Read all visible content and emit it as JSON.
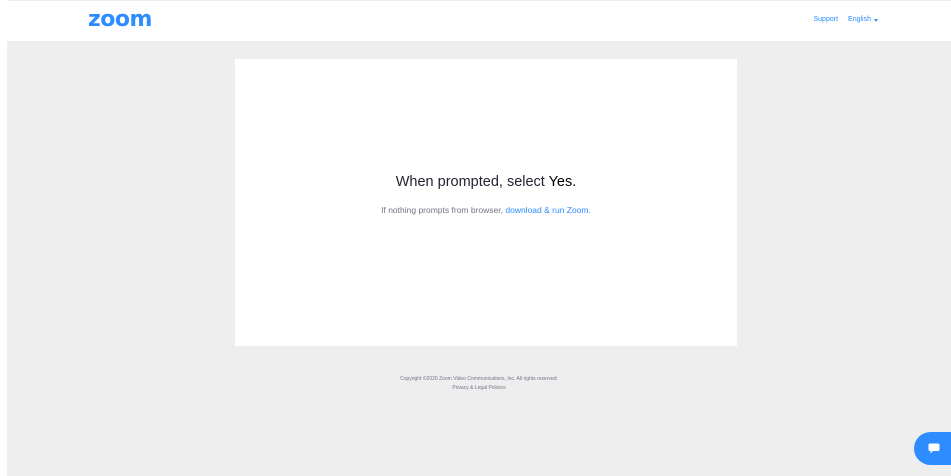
{
  "header": {
    "logo": "zoom",
    "support_label": "Support",
    "language_label": "English"
  },
  "prompt": {
    "title_prefix": "When prompted, select ",
    "title_emphasis": "Yes.",
    "subtitle_prefix": "If nothing prompts from browser, ",
    "subtitle_link": "download & run Zoom."
  },
  "footer": {
    "copyright": "Copyright ©2020 Zoom Video Communications, Inc. All rights reserved.",
    "privacy_link": "Privacy & Legal Policies"
  },
  "chat": {
    "icon": "chat-bubble-icon"
  },
  "colors": {
    "accent": "#2D8CFF",
    "background": "#EEEEEE",
    "text": "#232333",
    "muted": "#747487"
  }
}
